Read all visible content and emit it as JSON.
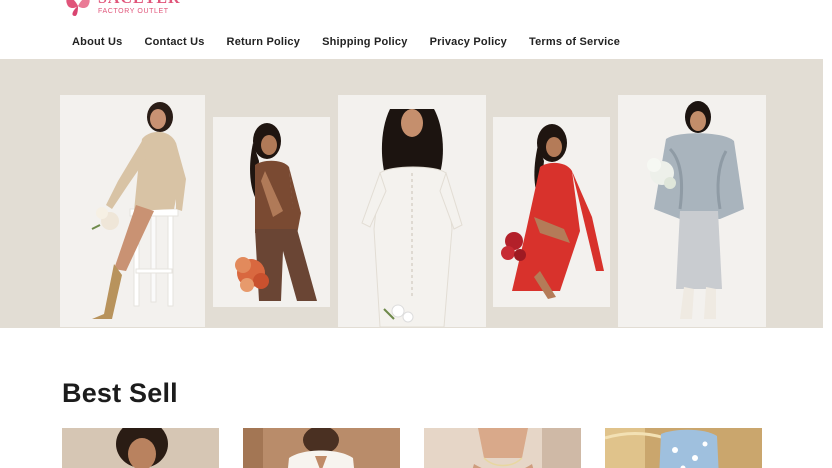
{
  "brand": {
    "name": "SACETER",
    "tagline": "FACTORY OUTLET",
    "accent_color": "#e0557a"
  },
  "nav": {
    "items": [
      {
        "label": "About Us"
      },
      {
        "label": "Contact Us"
      },
      {
        "label": "Return Policy"
      },
      {
        "label": "Shipping Policy"
      },
      {
        "label": "Privacy Policy"
      },
      {
        "label": "Terms of Service"
      }
    ]
  },
  "hero": {
    "background": "#e2ddd4",
    "models": [
      {
        "outfit": "beige knit dress",
        "color": "#d8c3a5"
      },
      {
        "outfit": "brown backless top",
        "color": "#7a4a32"
      },
      {
        "outfit": "white off-shoulder dress",
        "color": "#f4f2ee"
      },
      {
        "outfit": "red dress",
        "color": "#d8322c"
      },
      {
        "outfit": "grey faux-fur coat",
        "color": "#a9b4bd"
      }
    ]
  },
  "best_sell": {
    "title": "Best Sell",
    "products": [
      {
        "image": "model-portrait-1"
      },
      {
        "image": "model-white-shirt"
      },
      {
        "image": "model-neck-portrait"
      },
      {
        "image": "model-blue-floral"
      }
    ]
  }
}
